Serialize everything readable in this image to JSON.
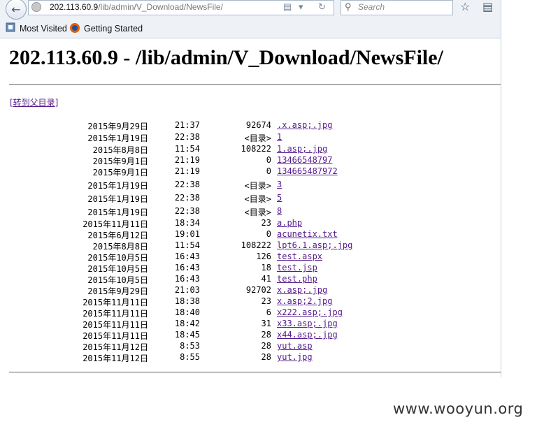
{
  "browser": {
    "url_host": "202.113.60.9",
    "url_path": "/lib/admin/V_Download/NewsFile/",
    "search_placeholder": "Search",
    "bookmarks": [
      "Most Visited",
      "Getting Started"
    ]
  },
  "page": {
    "title": "202.113.60.9 - /lib/admin/V_Download/NewsFile/",
    "parent_link": "[转到父目录]"
  },
  "listing": [
    {
      "date": "2015年9月29日",
      "time": "21:37",
      "size": "92674",
      "name": ".x.asp;.jpg"
    },
    {
      "date": "2015年1月19日",
      "time": "22:38",
      "size": "<目录>",
      "name": "1"
    },
    {
      "date": "2015年8月8日",
      "time": "11:54",
      "size": "108222",
      "name": "1.asp;.jpg"
    },
    {
      "date": "2015年9月1日",
      "time": "21:19",
      "size": "0",
      "name": "13466548797"
    },
    {
      "date": "2015年9月1日",
      "time": "21:19",
      "size": "0",
      "name": "134665487972"
    },
    {
      "date": "2015年1月19日",
      "time": "22:38",
      "size": "<目录>",
      "name": "3"
    },
    {
      "date": "2015年1月19日",
      "time": "22:38",
      "size": "<目录>",
      "name": "5"
    },
    {
      "date": "2015年1月19日",
      "time": "22:38",
      "size": "<目录>",
      "name": "8"
    },
    {
      "date": "2015年11月11日",
      "time": "18:34",
      "size": "23",
      "name": "a.php"
    },
    {
      "date": "2015年6月12日",
      "time": "19:01",
      "size": "0",
      "name": "acunetix.txt"
    },
    {
      "date": "2015年8月8日",
      "time": "11:54",
      "size": "108222",
      "name": "lpt6.1.asp;.jpg"
    },
    {
      "date": "2015年10月5日",
      "time": "16:43",
      "size": "126",
      "name": "test.aspx"
    },
    {
      "date": "2015年10月5日",
      "time": "16:43",
      "size": "18",
      "name": "test.jsp"
    },
    {
      "date": "2015年10月5日",
      "time": "16:43",
      "size": "41",
      "name": "test.php"
    },
    {
      "date": "2015年9月29日",
      "time": "21:03",
      "size": "92702",
      "name": "x.asp;.jpg"
    },
    {
      "date": "2015年11月11日",
      "time": "18:38",
      "size": "23",
      "name": "x.asp;2.jpg"
    },
    {
      "date": "2015年11月11日",
      "time": "18:40",
      "size": "6",
      "name": "x222.asp;.jpg"
    },
    {
      "date": "2015年11月11日",
      "time": "18:42",
      "size": "31",
      "name": "x33.asp;.jpg"
    },
    {
      "date": "2015年11月11日",
      "time": "18:45",
      "size": "28",
      "name": "x44.asp;.jpg"
    },
    {
      "date": "2015年11月12日",
      "time": "8:53",
      "size": "28",
      "name": "yut.asp"
    },
    {
      "date": "2015年11月12日",
      "time": "8:55",
      "size": "28",
      "name": "yut.jpg"
    }
  ],
  "watermark": "www.wooyun.org"
}
